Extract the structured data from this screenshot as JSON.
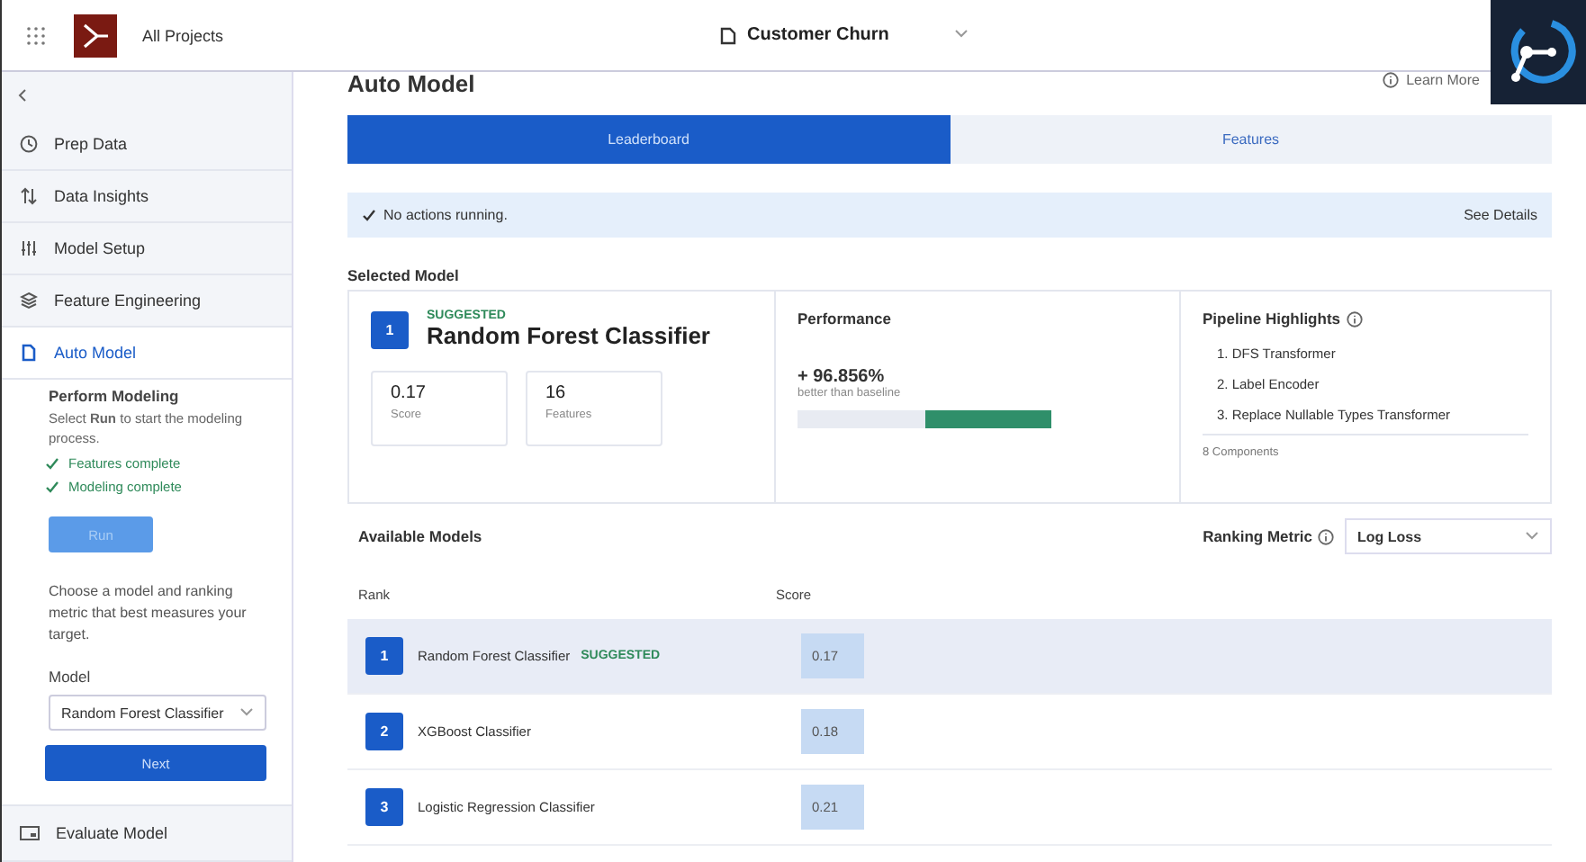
{
  "header": {
    "breadcrumb": "All Projects",
    "project": "Customer Churn"
  },
  "sidebar": {
    "items": [
      {
        "label": "Prep Data",
        "selected": false
      },
      {
        "label": "Data Insights",
        "selected": false
      },
      {
        "label": "Model Setup",
        "selected": false
      },
      {
        "label": "Feature Engineering",
        "selected": false
      },
      {
        "label": "Auto Model",
        "selected": true
      }
    ],
    "step": {
      "title": "Perform Modeling",
      "description": "Select **Run** to start the modeling process.",
      "checks": [
        {
          "label": "Features complete",
          "done": true
        },
        {
          "label": "Modeling complete",
          "done": true
        }
      ],
      "run_button": {
        "label": "Run",
        "disabled": true
      },
      "hint": "Choose a model and ranking metric that best measures your target.",
      "model_label": "Model",
      "model_value": "Random Forest Classifier",
      "next_button": "Next"
    },
    "footer_item": {
      "label": "Evaluate Model",
      "selected": false
    }
  },
  "page": {
    "title": "Auto Model",
    "learn_more": "Learn More"
  },
  "tabs": [
    {
      "label": "Leaderboard",
      "selected": true
    },
    {
      "label": "Features",
      "selected": false
    }
  ],
  "status": {
    "text": "No actions running.",
    "link": "See Details"
  },
  "selected_model": {
    "heading": "Selected Model",
    "rank": "1",
    "tag": "SUGGESTED",
    "name": "Random Forest Classifier",
    "stats": [
      {
        "value": "0.17",
        "label": "Score"
      },
      {
        "value": "16",
        "label": "Features"
      }
    ],
    "performance": {
      "title": "Performance",
      "value": "+ 96.856%",
      "caption": "better than baseline",
      "level": 0.5
    },
    "pipeline": {
      "title": "Pipeline Highlights",
      "steps": [
        "1. DFS Transformer",
        "2. Label Encoder",
        "3. Replace Nullable Types Transformer"
      ],
      "footer": "8 Components"
    }
  },
  "available_models": {
    "heading": "Available Models",
    "metric_label": "Ranking Metric",
    "metric_value": "Log Loss",
    "columns": [
      "Rank",
      "Score"
    ],
    "rows": [
      {
        "rank": "1",
        "name": "Random Forest Classifier",
        "tag": "SUGGESTED",
        "score": "0.17",
        "selected": true
      },
      {
        "rank": "2",
        "name": "XGBoost Classifier",
        "score": "0.18",
        "selected": false
      },
      {
        "rank": "3",
        "name": "Logistic Regression Classifier",
        "score": "0.21",
        "selected": false
      }
    ]
  }
}
